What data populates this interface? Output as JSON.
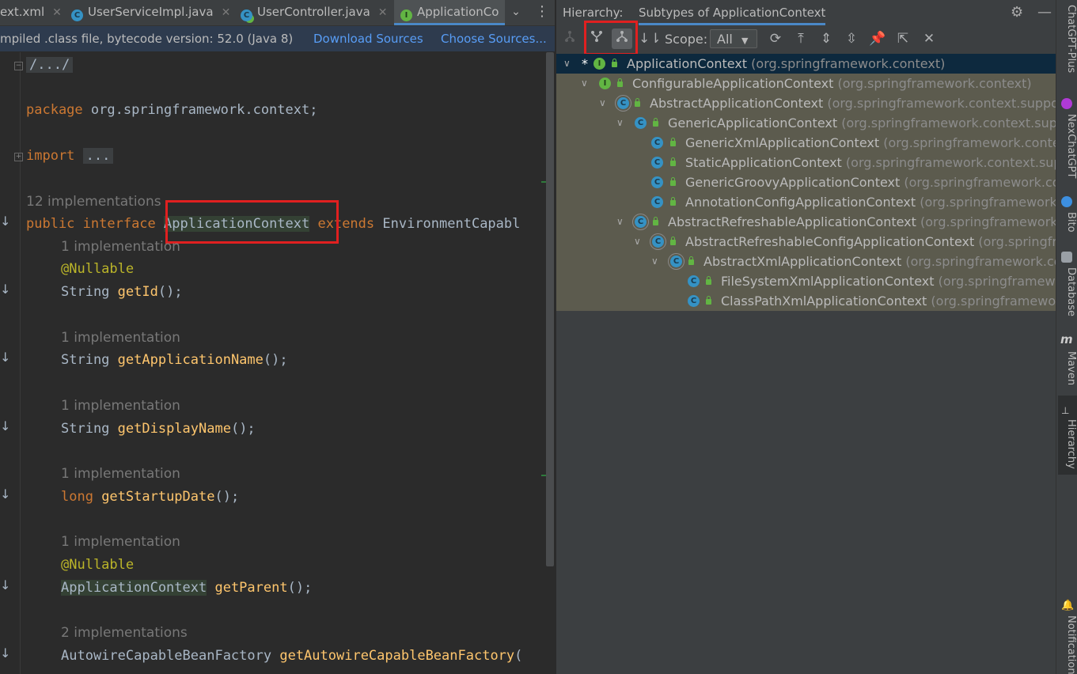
{
  "tabs": [
    {
      "label": "ext.xml",
      "icon": "xml-file-icon",
      "active": false
    },
    {
      "label": "UserServiceImpl.java",
      "icon": "class-icon",
      "active": false
    },
    {
      "label": "UserController.java",
      "icon": "class-icon",
      "active": false
    },
    {
      "label": "ApplicationCo",
      "icon": "interface-icon",
      "active": true
    }
  ],
  "banner": {
    "text": "mpiled .class file, bytecode version: 52.0 (Java 8)",
    "download": "Download Sources",
    "choose": "Choose Sources..."
  },
  "code": {
    "fold_header": "/.../",
    "package_kw": "package",
    "package_name": " org.springframework.context;",
    "import_kw": "import",
    "import_fold": "...",
    "impl_hint_12": "12 implementations",
    "decl_public": "public",
    "decl_interface": " interface ",
    "decl_name": "ApplicationContext",
    "decl_extends": " extends ",
    "decl_rest": "EnvironmentCapabl",
    "hint1": "1 implementation",
    "ann1": "@Nullable",
    "m1_type": "String ",
    "m1_name": "getId",
    "m1_end": "();",
    "hint2": "1 implementation",
    "m2_type": "String ",
    "m2_name": "getApplicationName",
    "m2_end": "();",
    "hint3": "1 implementation",
    "m3_type": "String ",
    "m3_name": "getDisplayName",
    "m3_end": "();",
    "hint4": "1 implementation",
    "m4_type": "long ",
    "m4_name": "getStartupDate",
    "m4_end": "();",
    "hint5": "1 implementation",
    "ann5": "@Nullable",
    "m5_type": "ApplicationContext",
    "m5_name": " getParent",
    "m5_end": "();",
    "hint6": "2 implementations",
    "m6_type": "AutowireCapableBeanFactory ",
    "m6_name": "getAutowireCapableBeanFactory",
    "m6_end": "("
  },
  "hierarchy": {
    "label": "Hierarchy:",
    "tab": "Subtypes of ApplicationContext",
    "scope_label": "Scope:",
    "scope_value": "All",
    "nodes": [
      {
        "name": "ApplicationContext",
        "pkg": "(org.springframework.context)",
        "kind": "interface",
        "star": "*"
      },
      {
        "name": "ConfigurableApplicationContext",
        "pkg": "(org.springframework.context)",
        "kind": "interface"
      },
      {
        "name": "AbstractApplicationContext",
        "pkg": "(org.springframework.context.support)",
        "kind": "abstract"
      },
      {
        "name": "GenericApplicationContext",
        "pkg": "(org.springframework.context.support)",
        "kind": "class"
      },
      {
        "name": "GenericXmlApplicationContext",
        "pkg": "(org.springframework.context.su",
        "kind": "class"
      },
      {
        "name": "StaticApplicationContext",
        "pkg": "(org.springframework.context.support",
        "kind": "class"
      },
      {
        "name": "GenericGroovyApplicationContext",
        "pkg": "(org.springframework.contex",
        "kind": "class"
      },
      {
        "name": "AnnotationConfigApplicationContext",
        "pkg": "(org.springframework.con",
        "kind": "class"
      },
      {
        "name": "AbstractRefreshableApplicationContext",
        "pkg": "(org.springframework.cont",
        "kind": "abstract"
      },
      {
        "name": "AbstractRefreshableConfigApplicationContext",
        "pkg": "(org.springframew",
        "kind": "abstract"
      },
      {
        "name": "AbstractXmlApplicationContext",
        "pkg": "(org.springframework.contex",
        "kind": "abstract"
      },
      {
        "name": "FileSystemXmlApplicationContext",
        "pkg": "(org.springframework.co",
        "kind": "class"
      },
      {
        "name": "ClassPathXmlApplicationContext",
        "pkg": "(org.springframework.co",
        "kind": "class"
      }
    ]
  },
  "sidebar": {
    "items": [
      {
        "label": "ChatGPT-Plus"
      },
      {
        "label": "NexChatGPT"
      },
      {
        "label": "Bito"
      },
      {
        "label": "Database"
      },
      {
        "label": "Maven"
      },
      {
        "label": "Hierarchy"
      },
      {
        "label": "Notifications"
      }
    ]
  },
  "colors": {
    "keyword": "#cc7832",
    "annotation": "#bbb529",
    "method": "#ffc66d",
    "highlight_box": "#e02020",
    "tree_bg": "#5c5b4e",
    "selected_row": "#0d293e"
  }
}
